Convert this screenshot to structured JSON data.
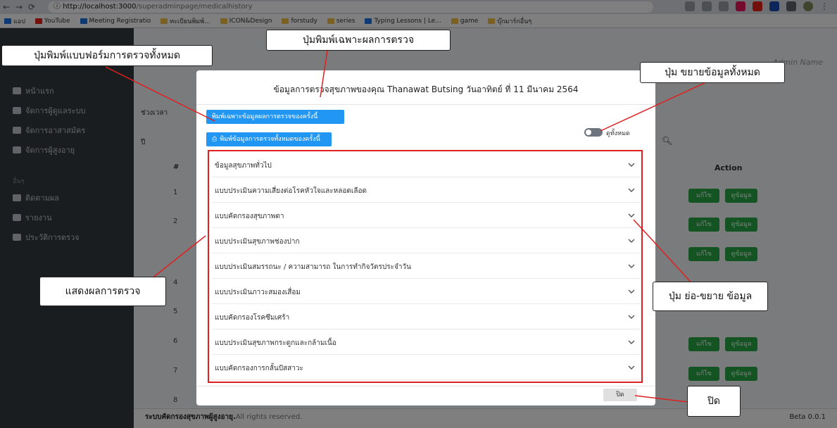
{
  "browser": {
    "address_host": "http://localhost:3000",
    "address_path": "/superadminpage/medicalhistory",
    "bookmarks": [
      {
        "label": "แอป",
        "color": "#1a73e8"
      },
      {
        "label": "YouTube",
        "color": "#e62117"
      },
      {
        "label": "Meeting Registratio",
        "color": "#1a73e8"
      },
      {
        "label": "ทะเบียนพิมพ์...",
        "color": "#f5c242"
      },
      {
        "label": "ICON&Design",
        "color": "#f5c242"
      },
      {
        "label": "forstudy",
        "color": "#f5c242"
      },
      {
        "label": "series",
        "color": "#f5c242"
      },
      {
        "label": "Typing Lessons | Le...",
        "color": "#1a73e8"
      },
      {
        "label": "game",
        "color": "#f5c242"
      },
      {
        "label": "บุ๊กมาร์กอื่นๆ",
        "color": "#f5c242"
      }
    ]
  },
  "sidebar": {
    "items": [
      {
        "label": "หน้าแรก"
      },
      {
        "label": "จัดการผู้ดูแลระบบ"
      },
      {
        "label": "จัดการอาสาสมัคร"
      },
      {
        "label": "จัดการผู้สูงอายุ"
      }
    ],
    "section_label": "อื่นๆ",
    "other_items": [
      {
        "label": "ติดตามผล"
      },
      {
        "label": "รายงาน"
      },
      {
        "label": "ประวัติการตรวจ"
      }
    ]
  },
  "main": {
    "admin_name": "Admin Name",
    "period_label": "ช่วงเวลา",
    "year_label": "ปี",
    "col_number": "#",
    "col_action": "Action",
    "edit_label": "แก้ไข",
    "view_label": "ดูข้อมูล"
  },
  "footer": {
    "brand": "ระบบคัดกรองสุขภาพผู้สูงอายุ.",
    "rights": "All rights reserved.",
    "version": "Beta 0.0.1"
  },
  "modal": {
    "title": "ข้อมูลการตรวจสุขภาพของคุณ Thanawat Butsing วันอาทิตย์ ที่ 11 มีนาคม 2564",
    "print_result_label": "พิมพ์เฉพาะข้อมูลผลการตรวจของครั้งนี้",
    "print_all_label": "พิมพ์ข้อมูลการตรวจทั้งหมดของครั้งนี้",
    "toggle_label": "ดูทั้งหมด",
    "sections": [
      "ข้อมูลสุขภาพทั่วไป",
      "แบบประเมินความเสี่ยงต่อโรคหัวใจและหลอดเลือด",
      "แบบคัดกรองสุขภาพตา",
      "แบบประเมินสุขภาพช่องปาก",
      "แบบประเมินสมรรถนะ / ความสามารถ ในการทำกิจวัตรประจำวัน",
      "แบบประเมินภาวะสมองเสื่อม",
      "แบบคัดกรองโรคซึมเศร้า",
      "แบบประเมินสุขภาพกระดูกและกล้ามเนื้อ",
      "แบบคัดกรองการกลั้นปัสสาวะ"
    ],
    "close_label": "ปิด"
  },
  "callouts": {
    "print_result": "ปุ่มพิมพ์เฉพาะผลการตรวจ",
    "print_all": "ปุ่มพิมพ์แบบฟอร์มการตรวจทั้งหมด",
    "expand_all": "ปุ่ม ขยายข้อมูลทั้งหมด",
    "results": "แสดงผลการตรวจ",
    "collapse_expand": "ปุ่ม ย่อ-ขยาย ข้อมูล",
    "close": "ปิด"
  },
  "colors": {
    "primary": "#2196f3",
    "success": "#28a745",
    "annotation": "#e02020",
    "sidebar": "#343a40"
  }
}
